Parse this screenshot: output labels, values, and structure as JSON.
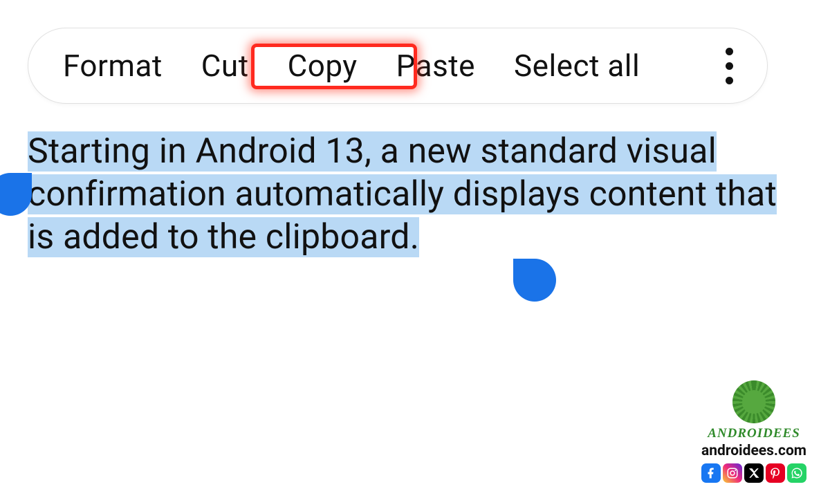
{
  "toolbar": {
    "format": "Format",
    "cut": "Cut",
    "copy": "Copy",
    "paste": "Paste",
    "select_all": "Select all"
  },
  "highlighted_action": "copy",
  "selected_text": "Starting in Android 13, a new standard visual confirmation automatically displays content that is added to the clipboard.",
  "watermark": {
    "brand": "ANDROIDEES",
    "url": "androidees.com"
  }
}
